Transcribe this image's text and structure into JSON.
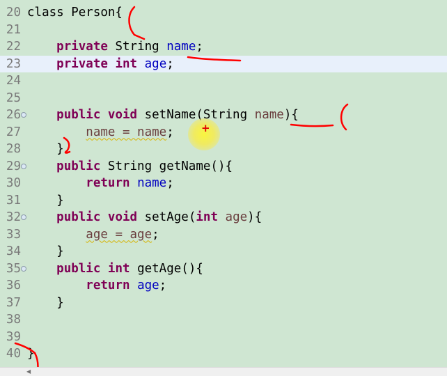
{
  "editor": {
    "current_line": "23",
    "lines": [
      {
        "no": "20",
        "parts": [
          {
            "t": "class Person{",
            "c": ""
          }
        ]
      },
      {
        "no": "21",
        "parts": []
      },
      {
        "no": "22",
        "parts": [
          {
            "t": "    ",
            "c": ""
          },
          {
            "t": "private",
            "c": "kw"
          },
          {
            "t": " String ",
            "c": ""
          },
          {
            "t": "name",
            "c": "fld"
          },
          {
            "t": ";",
            "c": ""
          }
        ]
      },
      {
        "no": "23",
        "parts": [
          {
            "t": "    ",
            "c": ""
          },
          {
            "t": "private",
            "c": "kw"
          },
          {
            "t": " ",
            "c": ""
          },
          {
            "t": "int",
            "c": "kw"
          },
          {
            "t": " ",
            "c": ""
          },
          {
            "t": "age",
            "c": "fld"
          },
          {
            "t": ";",
            "c": ""
          }
        ]
      },
      {
        "no": "24",
        "parts": []
      },
      {
        "no": "25",
        "parts": []
      },
      {
        "no": "26",
        "fold": true,
        "parts": [
          {
            "t": "    ",
            "c": ""
          },
          {
            "t": "public",
            "c": "kw"
          },
          {
            "t": " ",
            "c": ""
          },
          {
            "t": "void",
            "c": "kw"
          },
          {
            "t": " setName(String ",
            "c": ""
          },
          {
            "t": "name",
            "c": "loc"
          },
          {
            "t": "){",
            "c": ""
          }
        ]
      },
      {
        "no": "27",
        "parts": [
          {
            "t": "        ",
            "c": ""
          },
          {
            "t": "name = name",
            "c": "loc squiggle"
          },
          {
            "t": ";",
            "c": ""
          }
        ]
      },
      {
        "no": "28",
        "parts": [
          {
            "t": "    }",
            "c": ""
          }
        ]
      },
      {
        "no": "29",
        "fold": true,
        "parts": [
          {
            "t": "    ",
            "c": ""
          },
          {
            "t": "public",
            "c": "kw"
          },
          {
            "t": " String getName(){",
            "c": ""
          }
        ]
      },
      {
        "no": "30",
        "parts": [
          {
            "t": "        ",
            "c": ""
          },
          {
            "t": "return",
            "c": "kw"
          },
          {
            "t": " ",
            "c": ""
          },
          {
            "t": "name",
            "c": "fld"
          },
          {
            "t": ";",
            "c": ""
          }
        ]
      },
      {
        "no": "31",
        "parts": [
          {
            "t": "    }",
            "c": ""
          }
        ]
      },
      {
        "no": "32",
        "fold": true,
        "parts": [
          {
            "t": "    ",
            "c": ""
          },
          {
            "t": "public",
            "c": "kw"
          },
          {
            "t": " ",
            "c": ""
          },
          {
            "t": "void",
            "c": "kw"
          },
          {
            "t": " setAge(",
            "c": ""
          },
          {
            "t": "int",
            "c": "kw"
          },
          {
            "t": " ",
            "c": ""
          },
          {
            "t": "age",
            "c": "loc"
          },
          {
            "t": "){",
            "c": ""
          }
        ]
      },
      {
        "no": "33",
        "parts": [
          {
            "t": "        ",
            "c": ""
          },
          {
            "t": "age = age",
            "c": "loc squiggle"
          },
          {
            "t": ";",
            "c": ""
          }
        ]
      },
      {
        "no": "34",
        "parts": [
          {
            "t": "    }",
            "c": ""
          }
        ]
      },
      {
        "no": "35",
        "fold": true,
        "parts": [
          {
            "t": "    ",
            "c": ""
          },
          {
            "t": "public",
            "c": "kw"
          },
          {
            "t": " ",
            "c": ""
          },
          {
            "t": "int",
            "c": "kw"
          },
          {
            "t": " getAge(){",
            "c": ""
          }
        ]
      },
      {
        "no": "36",
        "parts": [
          {
            "t": "        ",
            "c": ""
          },
          {
            "t": "return",
            "c": "kw"
          },
          {
            "t": " ",
            "c": ""
          },
          {
            "t": "age",
            "c": "fld"
          },
          {
            "t": ";",
            "c": ""
          }
        ]
      },
      {
        "no": "37",
        "parts": [
          {
            "t": "    }",
            "c": ""
          }
        ]
      },
      {
        "no": "38",
        "parts": []
      },
      {
        "no": "39",
        "parts": []
      },
      {
        "no": "40",
        "parts": [
          {
            "t": "}",
            "c": ""
          }
        ]
      }
    ]
  },
  "cursor": {
    "marker": "+"
  },
  "colors": {
    "editor_background": "#cfe6d2",
    "current_line_highlight": "#e8f0fb",
    "keyword": "#7f0055",
    "field": "#0000c0",
    "local_variable": "#6a3e3e",
    "annotation_ink": "#ff0000",
    "cursor_highlight": "#f8f23c"
  },
  "icons": {
    "fold_marker": "fold-minus-icon",
    "scroll_left": "scroll-left-arrow-icon"
  }
}
